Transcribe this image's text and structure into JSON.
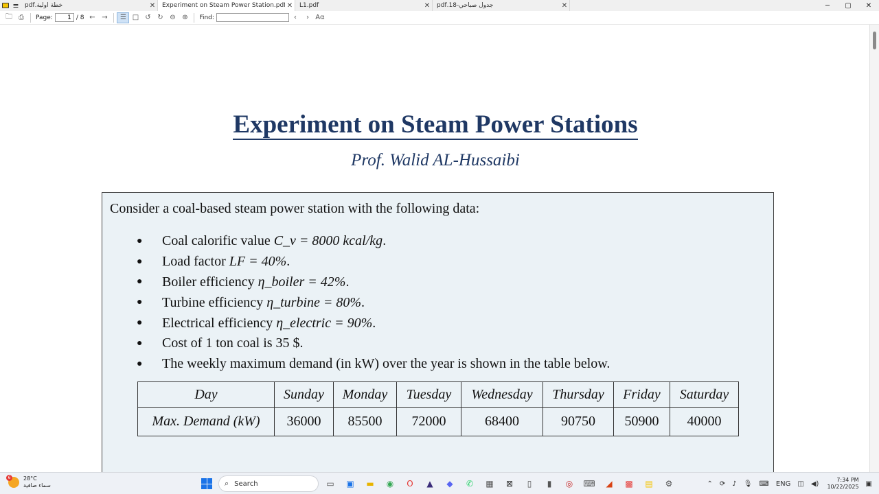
{
  "tabs": [
    {
      "label": "خطة اولية.pdf",
      "active": false,
      "rtl": true
    },
    {
      "label": "Experiment on Steam Power Station.pdf",
      "active": true,
      "rtl": false
    },
    {
      "label": "L1.pdf",
      "active": false,
      "rtl": false
    },
    {
      "label": "جدول صباحي-18.pdf",
      "active": false,
      "rtl": true
    }
  ],
  "toolbar": {
    "page_label": "Page:",
    "page_value": "1",
    "page_total": "/ 8",
    "find_label": "Find:",
    "case_label": "Aα"
  },
  "document": {
    "title": "Experiment on Steam Power Stations",
    "author": "Prof. Walid AL-Hussaibi",
    "intro": "Consider a coal-based steam power station with the following data:",
    "bullets": [
      {
        "text": "Coal calorific value ",
        "math": "C_v = 8000 kcal/kg",
        "suffix": "."
      },
      {
        "text": "Load factor ",
        "math": "LF = 40%",
        "suffix": " ."
      },
      {
        "text": "Boiler efficiency ",
        "math": "η_boiler = 42%",
        "suffix": " ."
      },
      {
        "text": "Turbine efficiency ",
        "math": "η_turbine = 80%",
        "suffix": " ."
      },
      {
        "text": "Electrical efficiency ",
        "math": "η_electric = 90%",
        "suffix": " ."
      },
      {
        "text": "Cost of 1 ton coal is 35 $",
        "math": "",
        "suffix": " ."
      },
      {
        "text": "The weekly maximum demand (in kW) over the year is shown in the table below.",
        "math": "",
        "suffix": ""
      }
    ],
    "table": {
      "header": [
        "Day",
        "Sunday",
        "Monday",
        "Tuesday",
        "Wednesday",
        "Thursday",
        "Friday",
        "Saturday"
      ],
      "row_label": "Max. Demand (kW)",
      "values": [
        "36000",
        "85500",
        "72000",
        "68400",
        "90750",
        "50900",
        "40000"
      ]
    }
  },
  "taskbar": {
    "temperature": "28°C",
    "weather_desc": "سماء صافية",
    "weather_badge": "6",
    "search_label": "Search",
    "lang": "ENG",
    "time": "7:34 PM",
    "date": "10/22/2025"
  }
}
